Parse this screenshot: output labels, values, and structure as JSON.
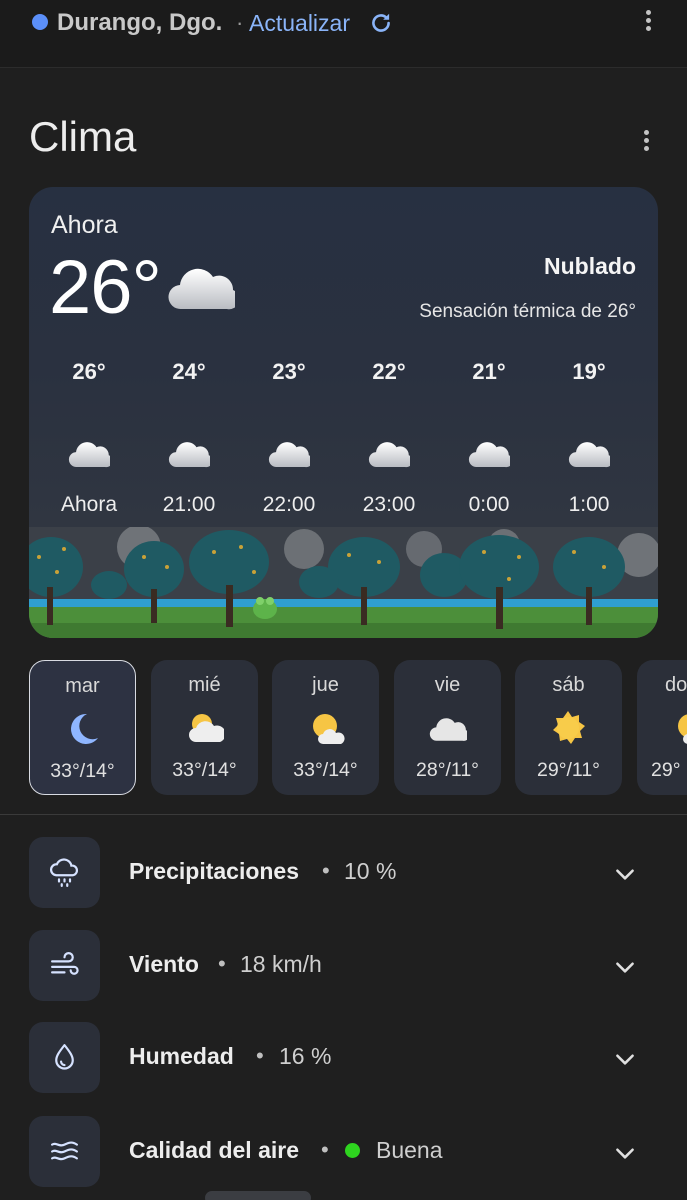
{
  "topbar": {
    "location": "Durango, Dgo.",
    "separator": "·",
    "refresh_label": "Actualizar"
  },
  "section_title": "Clima",
  "current": {
    "label": "Ahora",
    "temperature": "26°",
    "condition": "Nublado",
    "feels_like": "Sensación térmica de 26°",
    "icon": "cloud-icon"
  },
  "hourly": [
    {
      "temp": "26°",
      "time": "Ahora",
      "icon": "cloud-icon"
    },
    {
      "temp": "24°",
      "time": "21:00",
      "icon": "cloud-icon"
    },
    {
      "temp": "23°",
      "time": "22:00",
      "icon": "cloud-icon"
    },
    {
      "temp": "22°",
      "time": "23:00",
      "icon": "cloud-icon"
    },
    {
      "temp": "21°",
      "time": "0:00",
      "icon": "cloud-icon"
    },
    {
      "temp": "19°",
      "time": "1:00",
      "icon": "cloud-icon"
    }
  ],
  "daily": [
    {
      "day": "mar",
      "range": "33°/14°",
      "icon": "moon-icon",
      "selected": true
    },
    {
      "day": "mié",
      "range": "33°/14°",
      "icon": "partly-cloudy-icon"
    },
    {
      "day": "jue",
      "range": "33°/14°",
      "icon": "sun-cloud-icon"
    },
    {
      "day": "vie",
      "range": "28°/11°",
      "icon": "cloud-icon"
    },
    {
      "day": "sáb",
      "range": "29°/11°",
      "icon": "sun-icon"
    },
    {
      "day": "do",
      "range": "29°",
      "icon": "sun-cloud-icon"
    }
  ],
  "metrics": [
    {
      "label": "Precipitaciones",
      "value": "10 %",
      "icon": "rain-cloud-icon"
    },
    {
      "label": "Viento",
      "value": "18 km/h",
      "icon": "wind-icon"
    },
    {
      "label": "Humedad",
      "value": "16 %",
      "icon": "droplet-icon"
    },
    {
      "label": "Calidad del aire",
      "value": "Buena",
      "icon": "air-quality-icon",
      "status_color": "#2ed41f"
    }
  ],
  "colors": {
    "accent": "#8ab4f8",
    "location_dot": "#5b8ff9",
    "background": "#1f1f1f",
    "card": "#2b2f39"
  }
}
